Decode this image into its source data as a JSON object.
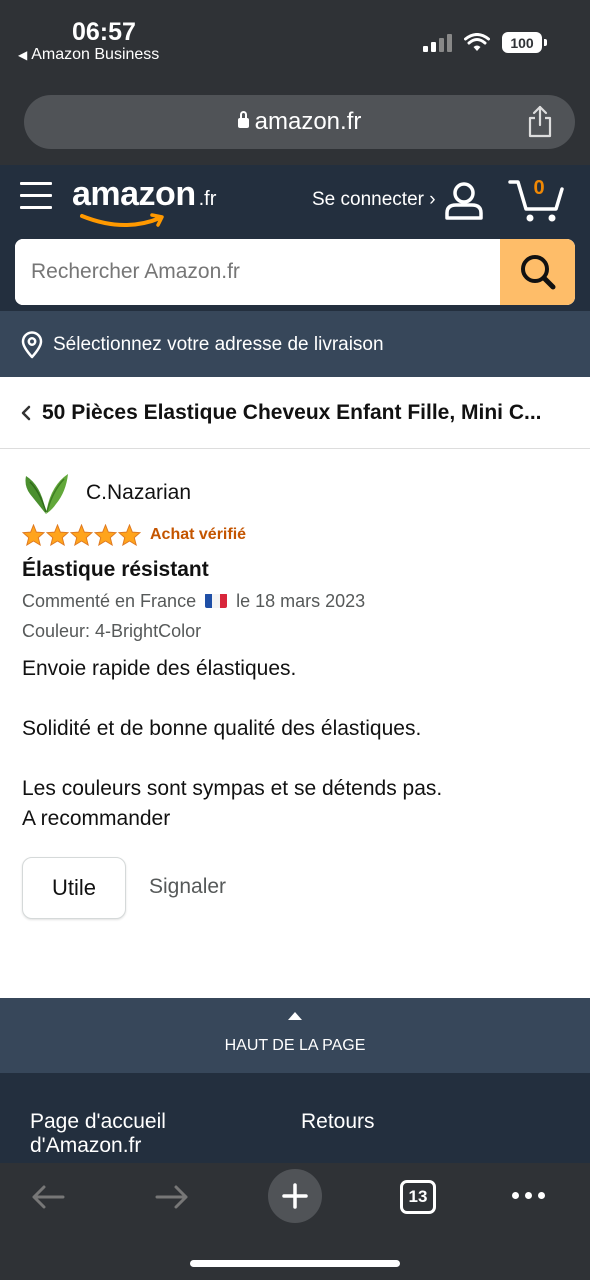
{
  "status_bar": {
    "time": "06:57",
    "back_app": "Amazon Business",
    "battery": "100"
  },
  "browser": {
    "url": "amazon.fr",
    "tab_count": "13"
  },
  "header": {
    "logo_text": "amazon",
    "logo_tld": ".fr",
    "signin_label": "Se connecter ›",
    "cart_count": "0",
    "search_placeholder": "Rechercher Amazon.fr",
    "delivery_label": "Sélectionnez votre adresse de livraison",
    "brand_color": "#232f3e",
    "search_button_color": "#febd69"
  },
  "product": {
    "title": "50 Pièces Elastique Cheveux Enfant Fille, Mini C..."
  },
  "review": {
    "reviewer": "C.Nazarian",
    "rating": 5,
    "verified_label": "Achat vérifié",
    "title": "Élastique résistant",
    "meta_prefix": "Commenté en France",
    "meta_date": "le 18 mars 2023",
    "variant": "Couleur: 4-BrightColor",
    "body": [
      "Envoie rapide des élastiques.",
      "Solidité et de bonne qualité des élastiques.",
      "Les couleurs sont sympas et se détends pas.",
      "A recommander"
    ],
    "helpful_button": "Utile",
    "report_link": "Signaler"
  },
  "footer": {
    "back_to_top": "HAUT DE LA PAGE",
    "link_home": "Page d'accueil d'Amazon.fr",
    "link_returns": "Retours"
  }
}
